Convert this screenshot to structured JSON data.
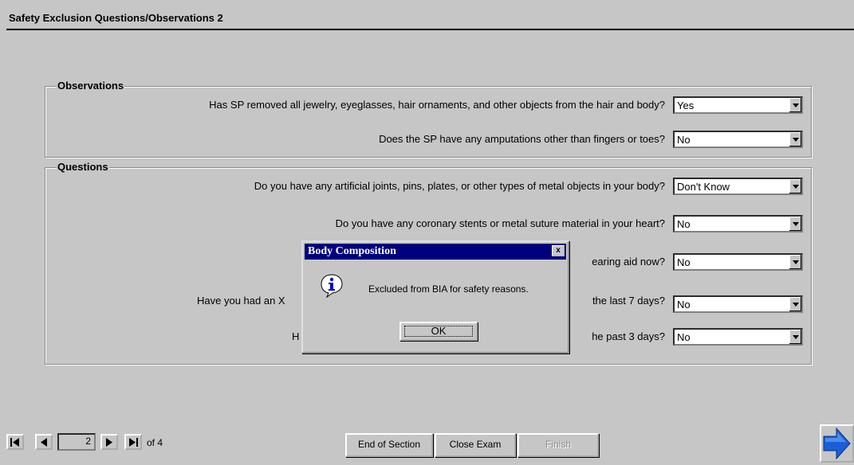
{
  "window": {
    "title": "Safety Exclusion Questions/Observations 2"
  },
  "observations": {
    "label": "Observations",
    "items": [
      {
        "question": "Has SP removed all jewelry, eyeglasses, hair ornaments, and other objects from the hair and body?",
        "answer": "Yes"
      },
      {
        "question": "Does the SP have any amputations other than fingers or toes?",
        "answer": "No"
      }
    ]
  },
  "questions": {
    "label": "Questions",
    "items": [
      {
        "question": "Do you have any artificial joints, pins, plates, or other types of metal objects in your body?",
        "answer": "Don't Know"
      },
      {
        "question": "Do you have any coronary stents or metal suture material in your heart?",
        "answer": "No"
      },
      {
        "question": "earing aid now?",
        "answer": "No"
      },
      {
        "question": "Have you had an X",
        "question_end": "the last 7 days?",
        "answer": "No"
      },
      {
        "question": "H",
        "question_end": "he past 3 days?",
        "answer": "No"
      }
    ]
  },
  "dialog": {
    "title": "Body Composition",
    "close": "x",
    "message": "Excluded from BIA for safety reasons.",
    "ok_label": "OK"
  },
  "navigation": {
    "current_page": "2",
    "of_text": "of 4"
  },
  "buttons": {
    "end_of_section": "End of Section",
    "close_exam": "Close Exam",
    "finish": "Finish"
  },
  "colors": {
    "background": "#c6c6c6",
    "dialog_title": "#00007f",
    "next_arrow": "#1a5fd6"
  }
}
